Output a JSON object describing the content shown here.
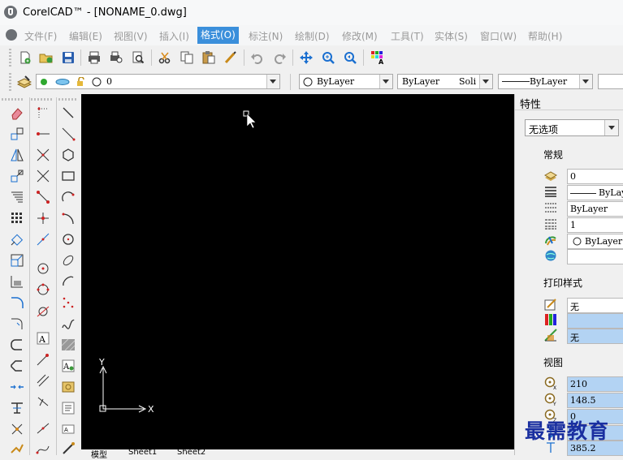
{
  "window": {
    "title": "CorelCAD™ - [NONAME_0.dwg]"
  },
  "menu": [
    {
      "label": "文件(F)",
      "active": false
    },
    {
      "label": "编辑(E)",
      "active": false
    },
    {
      "label": "视图(V)",
      "active": false
    },
    {
      "label": "插入(I)",
      "active": false
    },
    {
      "label": "格式(O)",
      "active": true
    },
    {
      "label": "标注(N)",
      "active": false
    },
    {
      "label": "绘制(D)",
      "active": false
    },
    {
      "label": "修改(M)",
      "active": false
    },
    {
      "label": "工具(T)",
      "active": false
    },
    {
      "label": "实体(S)",
      "active": false
    },
    {
      "label": "窗口(W)",
      "active": false
    },
    {
      "label": "帮助(H)",
      "active": false
    }
  ],
  "toolbar1": [
    "new-icon",
    "open-icon",
    "save-icon",
    "print-icon",
    "print-preview-icon",
    "page-setup-icon",
    "cut-icon",
    "copy-icon",
    "paste-icon",
    "match-properties-icon",
    "undo-icon",
    "redo-icon",
    "pan-icon",
    "zoom-window-icon",
    "zoom-previous-icon",
    "color-palette-icon"
  ],
  "layer_bar": {
    "layer_value": "0",
    "color_value": "ByLayer",
    "linetype_value": "ByLayer",
    "linetype_extra": "Soli",
    "lineweight_value": "ByLayer"
  },
  "tabs": [
    "模型",
    "Sheet1",
    "Sheet2"
  ],
  "properties": {
    "title": "特性",
    "selection": "无选项",
    "general": {
      "label": "常规",
      "layer": "0",
      "linetype": "ByLayer",
      "lineweight": "ByLayer",
      "linescale": "1",
      "color": "ByLayer",
      "hyperlink": ""
    },
    "print_style": {
      "label": "打印样式",
      "style": "无",
      "table": "",
      "table_type": "无"
    },
    "view": {
      "label": "视图",
      "center_x": "210",
      "center_y": "148.5",
      "center_z": "0",
      "height": "",
      "width": "385.2"
    }
  },
  "ucs": {
    "x_label": "X",
    "y_label": "Y"
  },
  "watermark": "最需教育",
  "colors": {
    "accent": "#3b8fdb",
    "canvas": "#000000",
    "highlight": "#b3d3f3"
  }
}
